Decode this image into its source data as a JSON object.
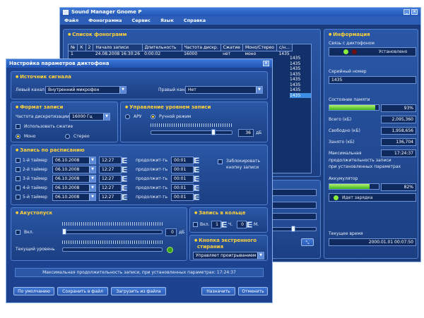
{
  "main_window": {
    "title": "Sound Manager Gnome P",
    "menu": [
      "Файл",
      "Фонограмма",
      "Сервис",
      "Язык",
      "Справка"
    ],
    "recordings": {
      "title": "Список фонограмм",
      "columns": [
        "№",
        "К",
        "2",
        "Начало записи",
        "Длительность",
        "Частота дискр.",
        "Сжатие",
        "Моно/Стерео",
        "с/н..."
      ],
      "row": [
        "1",
        "",
        "",
        "24.08.2008 16:30:26",
        "0:00:02",
        "16000",
        "нет",
        "моно",
        "1435"
      ],
      "extra_sn": [
        "1435",
        "1435",
        "1435",
        "1435",
        "1435",
        "1435",
        "1435",
        "1435"
      ]
    },
    "info": {
      "title": "Информация",
      "connection_label": "Связь с диктофоном",
      "connection_status": "Установлено",
      "serial_label": "Серийный номер",
      "serial_value": "1435",
      "memory_label": "Состояние памяти",
      "memory_percent_text": "93%",
      "memory_fraction": 0.93,
      "total_label": "Всего (кБ)",
      "total_value": "2,095,360",
      "free_label": "Свободно (кБ)",
      "free_value": "1,958,656",
      "used_label": "Занято (кБ)",
      "used_value": "136,704",
      "max_label": "Максимальная",
      "max_value": "17:24:37",
      "max_line2": "продолжительность записи",
      "max_line3": "при установленных параметрах",
      "battery_label": "Аккумулятор",
      "battery_percent_text": "82%",
      "battery_fraction": 0.82,
      "charging_text": "Идет зарядка",
      "time_label": "Текущее время",
      "time_value": "2000.01.01 00:07:50"
    }
  },
  "dialog": {
    "title": "Настройка параметров диктофона",
    "source": {
      "title": "Источник сигнала",
      "left_label": "Левый канал",
      "left_value": "Внутренний микрофон",
      "right_label": "Правый канал",
      "right_value": "Нет"
    },
    "format": {
      "title": "Формат записи",
      "rate_label": "Частота дискретизации",
      "rate_value": "16000 Гц",
      "compress_label": "Использовать сжатие",
      "mono_label": "Моно",
      "stereo_label": "Стерео"
    },
    "level": {
      "title": "Управление уровнем записи",
      "aru_label": "АРУ",
      "manual_label": "Ручной режим",
      "value": "36",
      "unit": "дБ",
      "slider_fraction": 0.78
    },
    "schedule": {
      "title": "Запись по расписанию",
      "duration_label": "продолжит-ть",
      "timers": [
        {
          "label": "1-й таймер",
          "date": "06.10.2008",
          "time": "12:27",
          "duration": "00:01"
        },
        {
          "label": "2-й таймер",
          "date": "06.10.2008",
          "time": "12:27",
          "duration": "00:01"
        },
        {
          "label": "3-й таймер",
          "date": "06.10.2008",
          "time": "12:27",
          "duration": "00:01"
        },
        {
          "label": "4-й таймер",
          "date": "06.10.2008",
          "time": "12:27",
          "duration": "00:01"
        },
        {
          "label": "5-й таймер",
          "date": "06.10.2008",
          "time": "12:27",
          "duration": "00:01"
        }
      ],
      "lock_line1": "Заблокировать",
      "lock_line2": "кнопку записи"
    },
    "vox": {
      "title": "Акустопуск",
      "on_label": "Вкл.",
      "value": "0",
      "unit": "дБ",
      "current_label": "Текущий уровень"
    },
    "loop": {
      "title": "Запись в кольце",
      "on_label": "Вкл.",
      "hours": "1",
      "hours_unit": "Ч.",
      "minutes": "0",
      "minutes_unit": "М."
    },
    "emergency": {
      "title_line1": "Кнопка экстренного",
      "title_line2": "стирания",
      "value": "Управляет проигрыванием"
    },
    "max_text": "Максимальная продолжительность записи, при установленных параметрах: 17:24:37",
    "buttons": {
      "default": "По умолчанию",
      "save": "Сохранить в файл",
      "load": "Загрузить из файла",
      "assign": "Назначить",
      "cancel": "Отменить"
    }
  },
  "colors": {
    "panel": "#2a57a6",
    "title_accent": "#ffd23a",
    "progress": "#38b51f",
    "selection": "#3d8fe6"
  }
}
